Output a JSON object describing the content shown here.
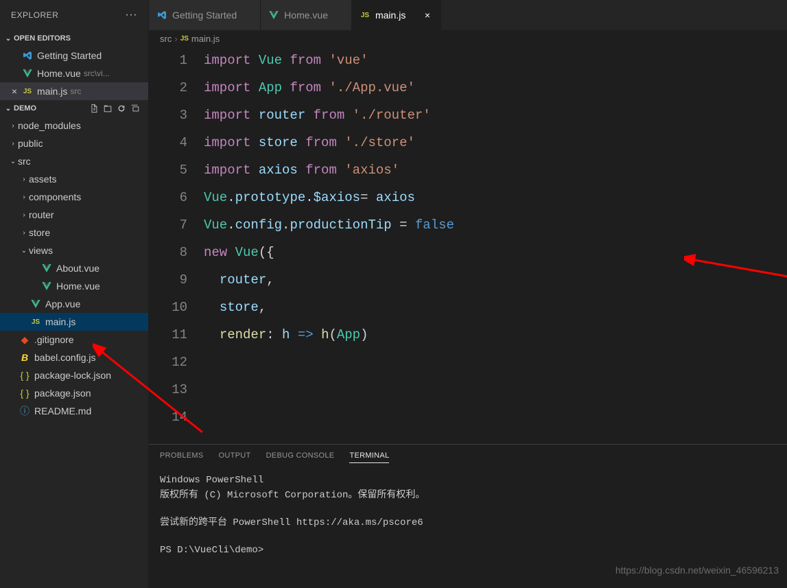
{
  "explorer": {
    "title": "EXPLORER",
    "openEditors": {
      "label": "OPEN EDITORS",
      "items": [
        {
          "name": "Getting Started",
          "icon": "vscode",
          "dir": ""
        },
        {
          "name": "Home.vue",
          "icon": "vue",
          "dir": "src\\vi..."
        },
        {
          "name": "main.js",
          "icon": "js",
          "dir": "src",
          "active": true
        }
      ]
    },
    "project": {
      "label": "DEMO",
      "tree": [
        {
          "name": "node_modules",
          "type": "folder",
          "collapsed": true,
          "depth": 1
        },
        {
          "name": "public",
          "type": "folder",
          "collapsed": true,
          "depth": 1
        },
        {
          "name": "src",
          "type": "folder",
          "collapsed": false,
          "depth": 1
        },
        {
          "name": "assets",
          "type": "folder",
          "collapsed": true,
          "depth": 2
        },
        {
          "name": "components",
          "type": "folder",
          "collapsed": true,
          "depth": 2
        },
        {
          "name": "router",
          "type": "folder",
          "collapsed": true,
          "depth": 2
        },
        {
          "name": "store",
          "type": "folder",
          "collapsed": true,
          "depth": 2
        },
        {
          "name": "views",
          "type": "folder",
          "collapsed": false,
          "depth": 2
        },
        {
          "name": "About.vue",
          "type": "file",
          "icon": "vue",
          "depth": 3
        },
        {
          "name": "Home.vue",
          "type": "file",
          "icon": "vue",
          "depth": 3
        },
        {
          "name": "App.vue",
          "type": "file",
          "icon": "vue",
          "depth": 2
        },
        {
          "name": "main.js",
          "type": "file",
          "icon": "js",
          "depth": 2,
          "selected": true
        },
        {
          "name": ".gitignore",
          "type": "file",
          "icon": "git",
          "depth": 1
        },
        {
          "name": "babel.config.js",
          "type": "file",
          "icon": "babel",
          "depth": 1
        },
        {
          "name": "package-lock.json",
          "type": "file",
          "icon": "json",
          "depth": 1
        },
        {
          "name": "package.json",
          "type": "file",
          "icon": "json",
          "depth": 1
        },
        {
          "name": "README.md",
          "type": "file",
          "icon": "info",
          "depth": 1
        }
      ]
    }
  },
  "tabs": [
    {
      "label": "Getting Started",
      "icon": "vscode"
    },
    {
      "label": "Home.vue",
      "icon": "vue"
    },
    {
      "label": "main.js",
      "icon": "js",
      "active": true,
      "closable": true
    }
  ],
  "breadcrumb": {
    "parts": [
      "src",
      "main.js"
    ],
    "icon": "js"
  },
  "code": {
    "lines": [
      [
        [
          "import ",
          "kw"
        ],
        [
          "Vue",
          "cls"
        ],
        [
          " ",
          "op"
        ],
        [
          "from",
          "kw"
        ],
        [
          " ",
          "op"
        ],
        [
          "'vue'",
          "str"
        ]
      ],
      [
        [
          "import ",
          "kw"
        ],
        [
          "App",
          "cls"
        ],
        [
          " ",
          "op"
        ],
        [
          "from",
          "kw"
        ],
        [
          " ",
          "op"
        ],
        [
          "'./App.vue'",
          "str"
        ]
      ],
      [
        [
          "import ",
          "kw"
        ],
        [
          "router",
          "var"
        ],
        [
          " ",
          "op"
        ],
        [
          "from",
          "kw"
        ],
        [
          " ",
          "op"
        ],
        [
          "'./router'",
          "str"
        ]
      ],
      [
        [
          "import ",
          "kw"
        ],
        [
          "store",
          "var"
        ],
        [
          " ",
          "op"
        ],
        [
          "from",
          "kw"
        ],
        [
          " ",
          "op"
        ],
        [
          "'./store'",
          "str"
        ]
      ],
      [
        [
          "",
          ""
        ]
      ],
      [
        [
          "import ",
          "kw"
        ],
        [
          "axios",
          "var"
        ],
        [
          " ",
          "op"
        ],
        [
          "from",
          "kw"
        ],
        [
          " ",
          "op"
        ],
        [
          "'axios'",
          "str"
        ]
      ],
      [
        [
          "Vue",
          "cls"
        ],
        [
          ".",
          "op"
        ],
        [
          "prototype",
          "var"
        ],
        [
          ".",
          "op"
        ],
        [
          "$axios",
          "var"
        ],
        [
          "= ",
          "op"
        ],
        [
          "axios",
          "var"
        ]
      ],
      [
        [
          "",
          ""
        ]
      ],
      [
        [
          "Vue",
          "cls"
        ],
        [
          ".",
          "op"
        ],
        [
          "config",
          "var"
        ],
        [
          ".",
          "op"
        ],
        [
          "productionTip",
          "var"
        ],
        [
          " = ",
          "op"
        ],
        [
          "false",
          "num"
        ]
      ],
      [
        [
          "",
          ""
        ]
      ],
      [
        [
          "new ",
          "kw"
        ],
        [
          "Vue",
          "cls"
        ],
        [
          "({",
          "op"
        ]
      ],
      [
        [
          "  ",
          "op"
        ],
        [
          "router",
          "var"
        ],
        [
          ",",
          "op"
        ]
      ],
      [
        [
          "  ",
          "op"
        ],
        [
          "store",
          "var"
        ],
        [
          ",",
          "op"
        ]
      ],
      [
        [
          "  ",
          "op"
        ],
        [
          "render",
          "fn"
        ],
        [
          ": ",
          "op"
        ],
        [
          "h",
          "var"
        ],
        [
          " => ",
          "num"
        ],
        [
          "h",
          "fn"
        ],
        [
          "(",
          "op"
        ],
        [
          "App",
          "cls"
        ],
        [
          ")",
          "op"
        ]
      ]
    ]
  },
  "panel": {
    "tabs": [
      "PROBLEMS",
      "OUTPUT",
      "DEBUG CONSOLE",
      "TERMINAL"
    ],
    "active": "TERMINAL",
    "terminal": {
      "line1": "Windows PowerShell",
      "line2": "版权所有 (C) Microsoft Corporation。保留所有权利。",
      "line3": "尝试新的跨平台 PowerShell https://aka.ms/pscore6",
      "prompt": "PS D:\\VueCli\\demo>"
    }
  },
  "watermark": "https://blog.csdn.net/weixin_46596213"
}
